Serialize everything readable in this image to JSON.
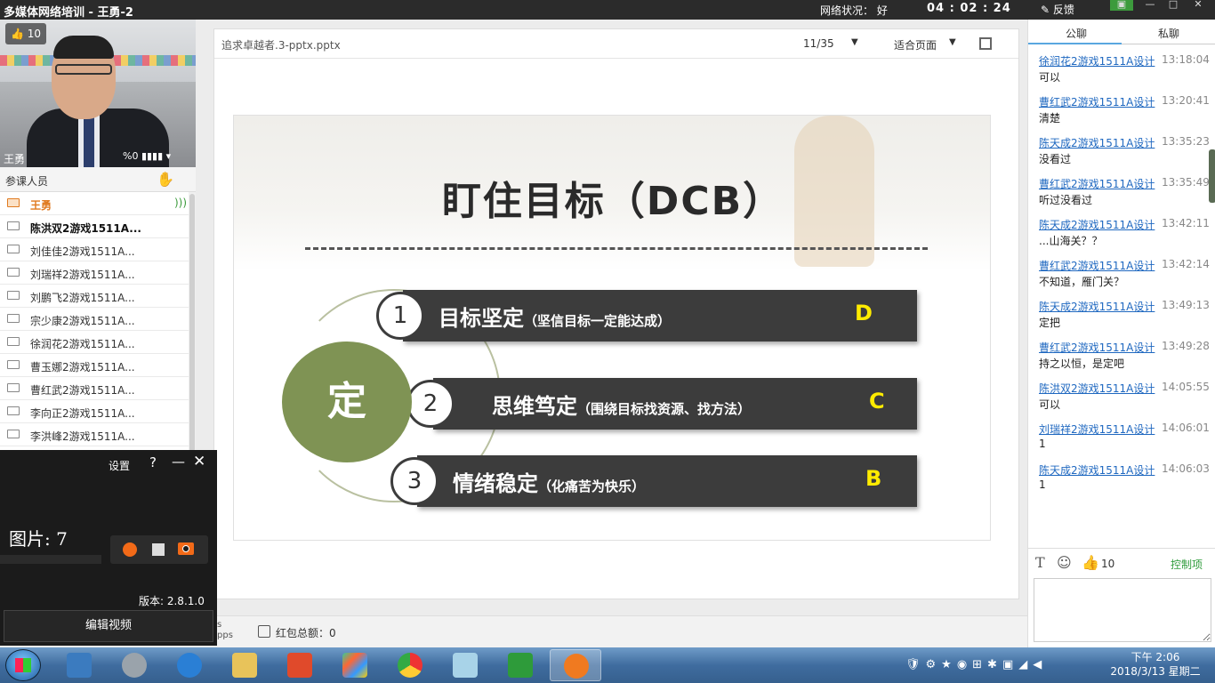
{
  "titlebar": {
    "title": "多媒体网络培训 - 王勇-2",
    "network": "网络状况： 好",
    "timer": "04 : 02 : 24",
    "feedback": "反馈"
  },
  "video": {
    "likes": "10",
    "name": "王勇",
    "controls": "%0 ▮▮▮▮ ▾"
  },
  "participants": {
    "header": "参课人员",
    "items": [
      {
        "name": "王勇"
      },
      {
        "name": "陈洪双2游戏1511A..."
      },
      {
        "name": "刘佳佳2游戏1511A..."
      },
      {
        "name": "刘瑞祥2游戏1511A..."
      },
      {
        "name": "刘鹏飞2游戏1511A..."
      },
      {
        "name": "宗少康2游戏1511A..."
      },
      {
        "name": "徐润花2游戏1511A..."
      },
      {
        "name": "曹玉娜2游戏1511A..."
      },
      {
        "name": "曹红武2游戏1511A..."
      },
      {
        "name": "李向正2游戏1511A..."
      },
      {
        "name": "李洪峰2游戏1511A..."
      }
    ]
  },
  "recorder": {
    "settings": "设置",
    "help": "?",
    "minimize": "—",
    "close": "✕",
    "pictures": "图片: 7",
    "version": "版本: 2.8.1.0",
    "edit_video": "编辑视频"
  },
  "document": {
    "filename": "追求卓越者.3-pptx.pptx",
    "page": "11/35",
    "fit": "适合页面"
  },
  "slide": {
    "title": "盯住目标（DCB）",
    "center": "定",
    "items": [
      {
        "num": "1",
        "main": "目标坚定",
        "sub": "（坚信目标一定能达成）",
        "letter": "D"
      },
      {
        "num": "2",
        "main": "思维笃定",
        "sub": "（围绕目标找资源、找方法）",
        "letter": "C"
      },
      {
        "num": "3",
        "main": "情绪稳定",
        "sub": "（化痛苦为快乐）",
        "letter": "B"
      }
    ]
  },
  "bottom": {
    "redpacket": "红包总额：0",
    "app_text": "s\npps"
  },
  "chat": {
    "tab_public": "公聊",
    "tab_private": "私聊",
    "messages": [
      {
        "who": "徐润花2游戏1511A设计",
        "time": "13:18:04",
        "text": "可以"
      },
      {
        "who": "曹红武2游戏1511A设计",
        "time": "13:20:41",
        "text": "清楚"
      },
      {
        "who": "陈天成2游戏1511A设计",
        "time": "13:35:23",
        "text": "没看过"
      },
      {
        "who": "曹红武2游戏1511A设计",
        "time": "13:35:49",
        "text": "听过没看过"
      },
      {
        "who": "陈天成2游戏1511A设计",
        "time": "13:42:11",
        "text": "...山海关？？"
      },
      {
        "who": "曹红武2游戏1511A设计",
        "time": "13:42:14",
        "text": "不知道，雁门关？"
      },
      {
        "who": "陈天成2游戏1511A设计",
        "time": "13:49:13",
        "text": "定把"
      },
      {
        "who": "曹红武2游戏1511A设计",
        "time": "13:49:28",
        "text": "持之以恒，是定吧"
      },
      {
        "who": "陈洪双2游戏1511A设计",
        "time": "14:05:55",
        "text": "可以"
      },
      {
        "who": "刘瑞祥2游戏1511A设计",
        "time": "14:06:01",
        "text": "1"
      },
      {
        "who": "陈天成2游戏1511A设计",
        "time": "14:06:03",
        "text": "1"
      }
    ],
    "toolbar_text": "T",
    "toolbar_emoji": "☺",
    "toolbar_like": "10",
    "control": "控制项"
  },
  "taskbar": {
    "clock_time": "下午 2:06",
    "clock_date": "2018/3/13 星期二"
  }
}
